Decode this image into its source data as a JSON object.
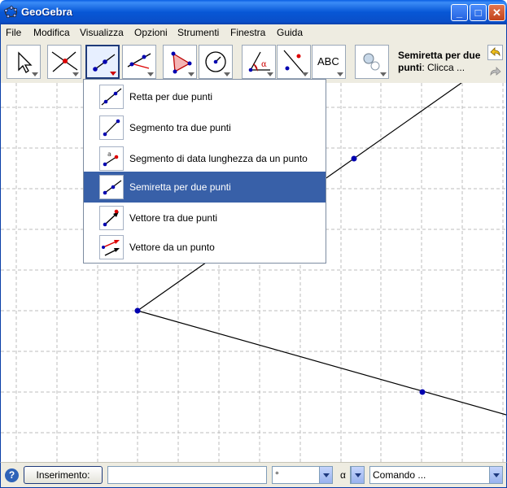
{
  "window": {
    "title": "GeoGebra",
    "controls": {
      "minimize": "_",
      "maximize": "□",
      "close": "✕"
    }
  },
  "menubar": {
    "items": [
      "File",
      "Modifica",
      "Visualizza",
      "Opzioni",
      "Strumenti",
      "Finestra",
      "Guida"
    ]
  },
  "toolbar": {
    "tools": [
      {
        "name": "move-tool",
        "icon": "arrow-cursor-icon"
      },
      {
        "name": "point-tool",
        "icon": "point-intersect-icon"
      },
      {
        "name": "line-tool",
        "icon": "ray-icon",
        "selected": true
      },
      {
        "name": "perpendicular-tool",
        "icon": "perpendicular-lines-icon"
      },
      {
        "name": "polygon-tool",
        "icon": "polygon-icon"
      },
      {
        "name": "circle-tool",
        "icon": "circle-icon"
      },
      {
        "name": "angle-tool",
        "icon": "angle-icon"
      },
      {
        "name": "reflect-tool",
        "icon": "reflect-icon"
      },
      {
        "name": "text-tool",
        "icon": "abc-text-icon",
        "label": "ABC"
      },
      {
        "name": "show-hide-tool",
        "icon": "show-hide-object-icon"
      }
    ],
    "help": {
      "title": "Semiretta per due punti",
      "separator": ":",
      "desc": "Clicca ..."
    }
  },
  "dropdown": {
    "items": [
      {
        "label": "Retta per due punti",
        "icon": "line-through-two-points-icon"
      },
      {
        "label": "Segmento tra due punti",
        "icon": "segment-icon"
      },
      {
        "label": "Segmento di data lunghezza da un punto",
        "icon": "segment-given-length-icon"
      },
      {
        "label": "Semiretta per due punti",
        "icon": "ray-icon",
        "active": true
      },
      {
        "label": "Vettore tra due punti",
        "icon": "vector-icon"
      },
      {
        "label": "Vettore da un punto",
        "icon": "vector-from-point-icon"
      }
    ]
  },
  "inputbar": {
    "help": "?",
    "input_label": "Inserimento:",
    "input_value": "",
    "degree_value": "°",
    "alpha_value": "α",
    "command_value": "Comando ..."
  },
  "colors": {
    "titlebar": "#0a5fe3",
    "selection": "#3860a8",
    "point": "#0000b0"
  }
}
